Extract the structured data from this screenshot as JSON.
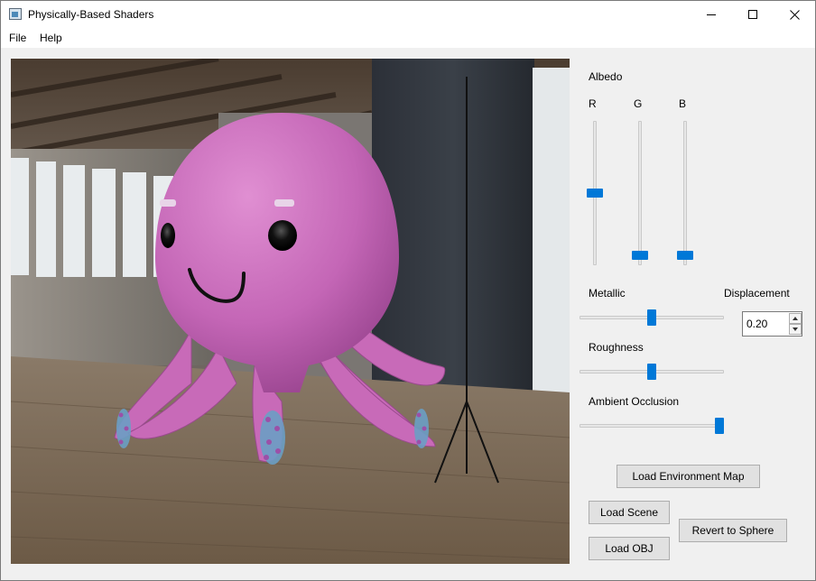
{
  "window": {
    "title": "Physically-Based Shaders",
    "icon": "app-window-icon",
    "controls": {
      "minimize": "minimize-icon",
      "maximize": "maximize-icon",
      "close": "close-icon"
    }
  },
  "menu": {
    "file": "File",
    "help": "Help"
  },
  "viewport": {
    "scene": "pink octopus model rendered in a wooden-floored loft environment"
  },
  "panel": {
    "albedo": {
      "label": "Albedo",
      "r": {
        "label": "R",
        "value": 0.5
      },
      "g": {
        "label": "G",
        "value": 0.04
      },
      "b": {
        "label": "B",
        "value": 0.04
      }
    },
    "metallic": {
      "label": "Metallic",
      "value": 0.5
    },
    "displacement": {
      "label": "Displacement",
      "value": "0.20"
    },
    "roughness": {
      "label": "Roughness",
      "value": 0.5
    },
    "ambient_occlusion": {
      "label": "Ambient Occlusion",
      "value": 1.0
    },
    "buttons": {
      "load_environment_map": "Load Environment Map",
      "load_scene": "Load Scene",
      "load_obj": "Load OBJ",
      "revert_to_sphere": "Revert to Sphere"
    }
  },
  "colors": {
    "accent": "#0078d7",
    "octopus": "#c768b8",
    "suckers": "#6a9fc4"
  }
}
